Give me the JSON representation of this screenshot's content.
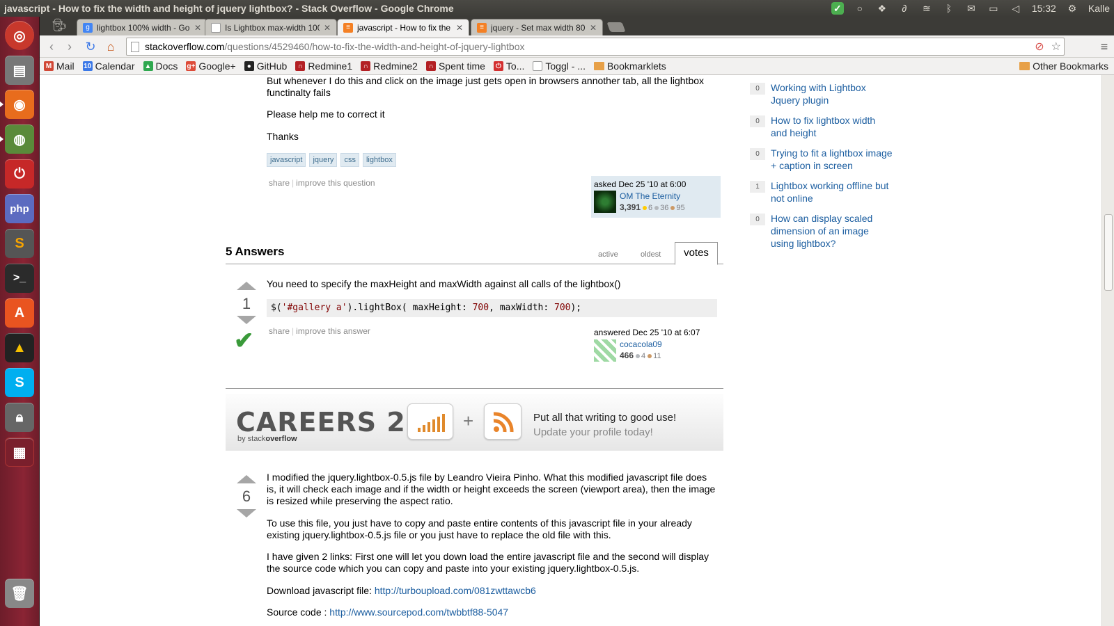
{
  "system": {
    "window_title": "javascript - How to fix the width and height of jquery lightbox? - Stack Overflow - Google Chrome",
    "clock": "15:32",
    "user": "Kalle"
  },
  "tabs": [
    {
      "label": "lightbox 100% width - Go",
      "active": false
    },
    {
      "label": "Is Lightbox max-width 100",
      "active": false
    },
    {
      "label": "javascript - How to fix the",
      "active": true
    },
    {
      "label": "jquery - Set max width 80",
      "active": false
    }
  ],
  "omnibox": {
    "host": "stackoverflow.com",
    "path": "/questions/4529460/how-to-fix-the-width-and-height-of-jquery-lightbox"
  },
  "bookmarks": [
    {
      "label": "Mail",
      "icon": "gmail-icon",
      "color": "#d14836",
      "glyph": "M"
    },
    {
      "label": "Calendar",
      "icon": "calendar-icon",
      "color": "#3b78e7",
      "glyph": "10"
    },
    {
      "label": "Docs",
      "icon": "drive-icon",
      "color": "#2fa84f",
      "glyph": "▲"
    },
    {
      "label": "Google+",
      "icon": "googleplus-icon",
      "color": "#dd4b39",
      "glyph": "g+"
    },
    {
      "label": "GitHub",
      "icon": "github-icon",
      "color": "#222222",
      "glyph": "●"
    },
    {
      "label": "Redmine1",
      "icon": "redmine-icon",
      "color": "#b32024",
      "glyph": "∩"
    },
    {
      "label": "Redmine2",
      "icon": "redmine-icon",
      "color": "#b32024",
      "glyph": "∩"
    },
    {
      "label": "Spent time",
      "icon": "redmine-icon",
      "color": "#b32024",
      "glyph": "∩"
    },
    {
      "label": "To...",
      "icon": "power-icon",
      "color": "#d32f2f",
      "glyph": "⏻"
    },
    {
      "label": "Toggl - ...",
      "icon": "page-icon",
      "color": "#aaaaaa",
      "glyph": ""
    },
    {
      "label": "Bookmarklets",
      "icon": "folder-icon",
      "color": "#e7a047",
      "glyph": ""
    }
  ],
  "other_bookmarks": "Other Bookmarks",
  "question": {
    "para1": "But whenever I do this and click on the image just gets open in browsers annother tab, all the lightbox functinalty fails",
    "para2": "Please help me to correct it",
    "para3": "Thanks",
    "tags": [
      "javascript",
      "jquery",
      "css",
      "lightbox"
    ],
    "menu_share": "share",
    "menu_improve": "improve this question",
    "asked": "asked Dec 25 '10 at 6:00",
    "user": "OM The Eternity",
    "rep": "3,391",
    "gold": "6",
    "silver": "36",
    "bronze": "95"
  },
  "answers_header": {
    "count": "5 Answers",
    "tab_active": "active",
    "tab_oldest": "oldest",
    "tab_votes": "votes"
  },
  "answer1": {
    "votes": "1",
    "text": "You need to specify the maxHeight and maxWidth against all calls of the lightbox()",
    "menu_share": "share",
    "menu_improve": "improve this answer",
    "answered": "answered Dec 25 '10 at 6:07",
    "user": "cocacola09",
    "rep": "466",
    "silver": "4",
    "bronze": "11"
  },
  "careers": {
    "logo": "CAREERS 2.0",
    "by_prefix": "by stack",
    "by_bold": "overflow",
    "plus": "+",
    "line1": "Put all that writing to good use!",
    "line2": "Update your profile today!"
  },
  "answer2": {
    "votes": "6",
    "para1": "I modified the jquery.lightbox-0.5.js file by Leandro Vieira Pinho. What this modified javascript file does is, it will check each image and if the width or height exceeds the screen (viewport area), then the image is resized while preserving the aspect ratio.",
    "para2": "To use this file, you just have to copy and paste entire contents of this javascript file in your already existing jquery.lightbox-0.5.js file or you just have to replace the old file with this.",
    "para3": "I have given 2 links: First one will let you down load the entire javascript file and the second will display the source code which you can copy and paste into your existing jquery.lightbox-0.5.js.",
    "download_label": "Download javascript file: ",
    "download_link": "http://turboupload.com/081zwttawcb6",
    "source_label": "Source code : ",
    "source_link": "http://www.sourcepod.com/twbbtf88-5047"
  },
  "sidebar": [
    {
      "count": "0",
      "title": "Working with Lightbox Jquery plugin"
    },
    {
      "count": "0",
      "title": "How to fix lightbox width and height"
    },
    {
      "count": "0",
      "title": "Trying to fit a lightbox image + caption in screen"
    },
    {
      "count": "1",
      "title": "Lightbox working offline but not online"
    },
    {
      "count": "0",
      "title": "How can display scaled dimension of an image using lightbox?"
    }
  ],
  "colors": {
    "launcher": "#8a2434",
    "link": "#1c5ea0",
    "tag_bg": "#e0eaf1",
    "accepted": "#3a9a3a",
    "gold": "#ffcc01",
    "silver": "#b4b8bc",
    "bronze": "#cc9966"
  }
}
